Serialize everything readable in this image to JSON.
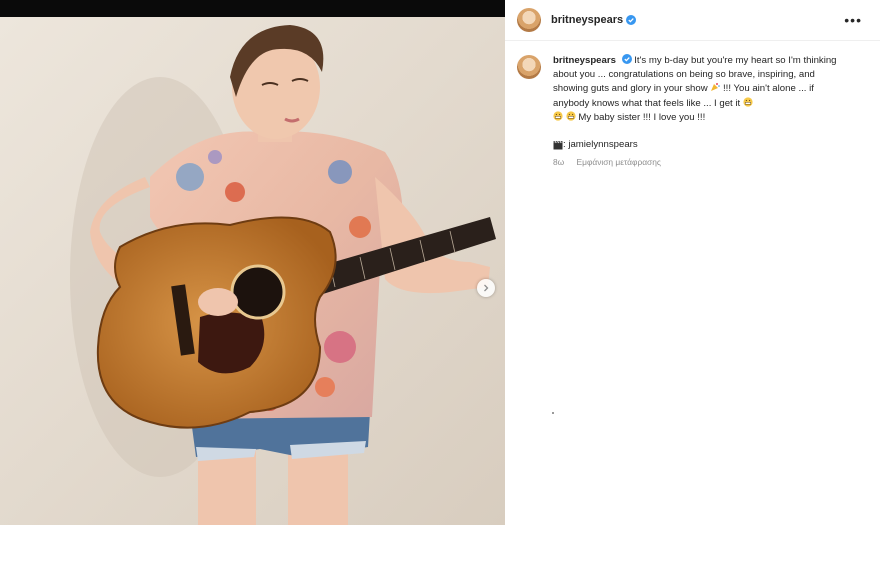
{
  "post": {
    "username": "britneyspears",
    "caption": "It's my b-day but you're my heart so I'm thinking about you ... congratulations on being so brave, inspiring, and showing guts and glory in your show",
    "caption_part2": "!!! You ain't alone ... if anybody knows what that feels like ... I get it",
    "caption_part3": "My baby sister !!! I love you !!!",
    "tag": ": jamielynnspears",
    "time_ago": "8ω",
    "translate_label": "Εμφάνιση μετάφρασης",
    "more_label": "•••"
  },
  "media": {
    "image_desc_icon": "photo",
    "carousel_count": 2,
    "carousel_index": 1
  },
  "icons": {
    "verified": "verified-badge-icon",
    "next": "chevron-right-icon",
    "tag_emoji": "clapper-board-icon"
  },
  "colors": {
    "verified": "#3897f0",
    "text": "#262626",
    "muted": "#8e8e8e"
  }
}
